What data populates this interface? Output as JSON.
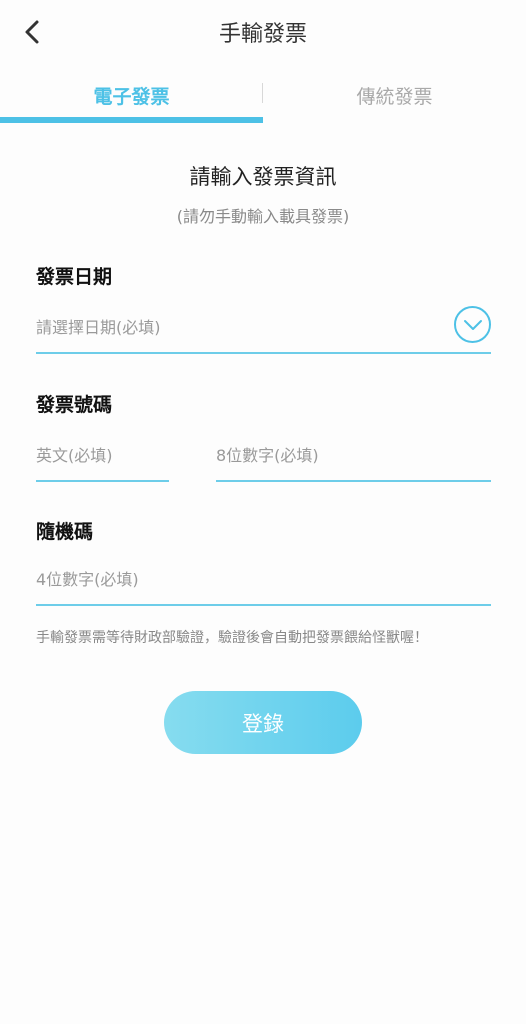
{
  "header": {
    "back_icon": "chevron-left-icon",
    "title": "手輸發票"
  },
  "tabs": [
    {
      "label": "電子發票",
      "active": true
    },
    {
      "label": "傳統發票",
      "active": false
    }
  ],
  "form": {
    "heading": "請輸入發票資訊",
    "subheading": "(請勿手動輸入載具發票)",
    "date": {
      "label": "發票日期",
      "value": "",
      "placeholder": "請選擇日期(必填)",
      "toggle_icon": "chevron-down-circle-icon"
    },
    "invoice_number": {
      "label": "發票號碼",
      "letters": {
        "value": "",
        "placeholder": "英文(必填)"
      },
      "digits": {
        "value": "",
        "placeholder": "8位數字(必填)"
      }
    },
    "random_code": {
      "label": "隨機碼",
      "value": "",
      "placeholder": "4位數字(必填)"
    },
    "note": "手輸發票需等待財政部驗證，驗證後會自動把發票餵給怪獸喔！",
    "submit_label": "登錄"
  },
  "colors": {
    "accent": "#4dc1e6",
    "underline": "#6dcde9",
    "button_gradient_start": "#86dcef",
    "button_gradient_end": "#5ccced",
    "inactive_tab": "#a9a9a9"
  }
}
